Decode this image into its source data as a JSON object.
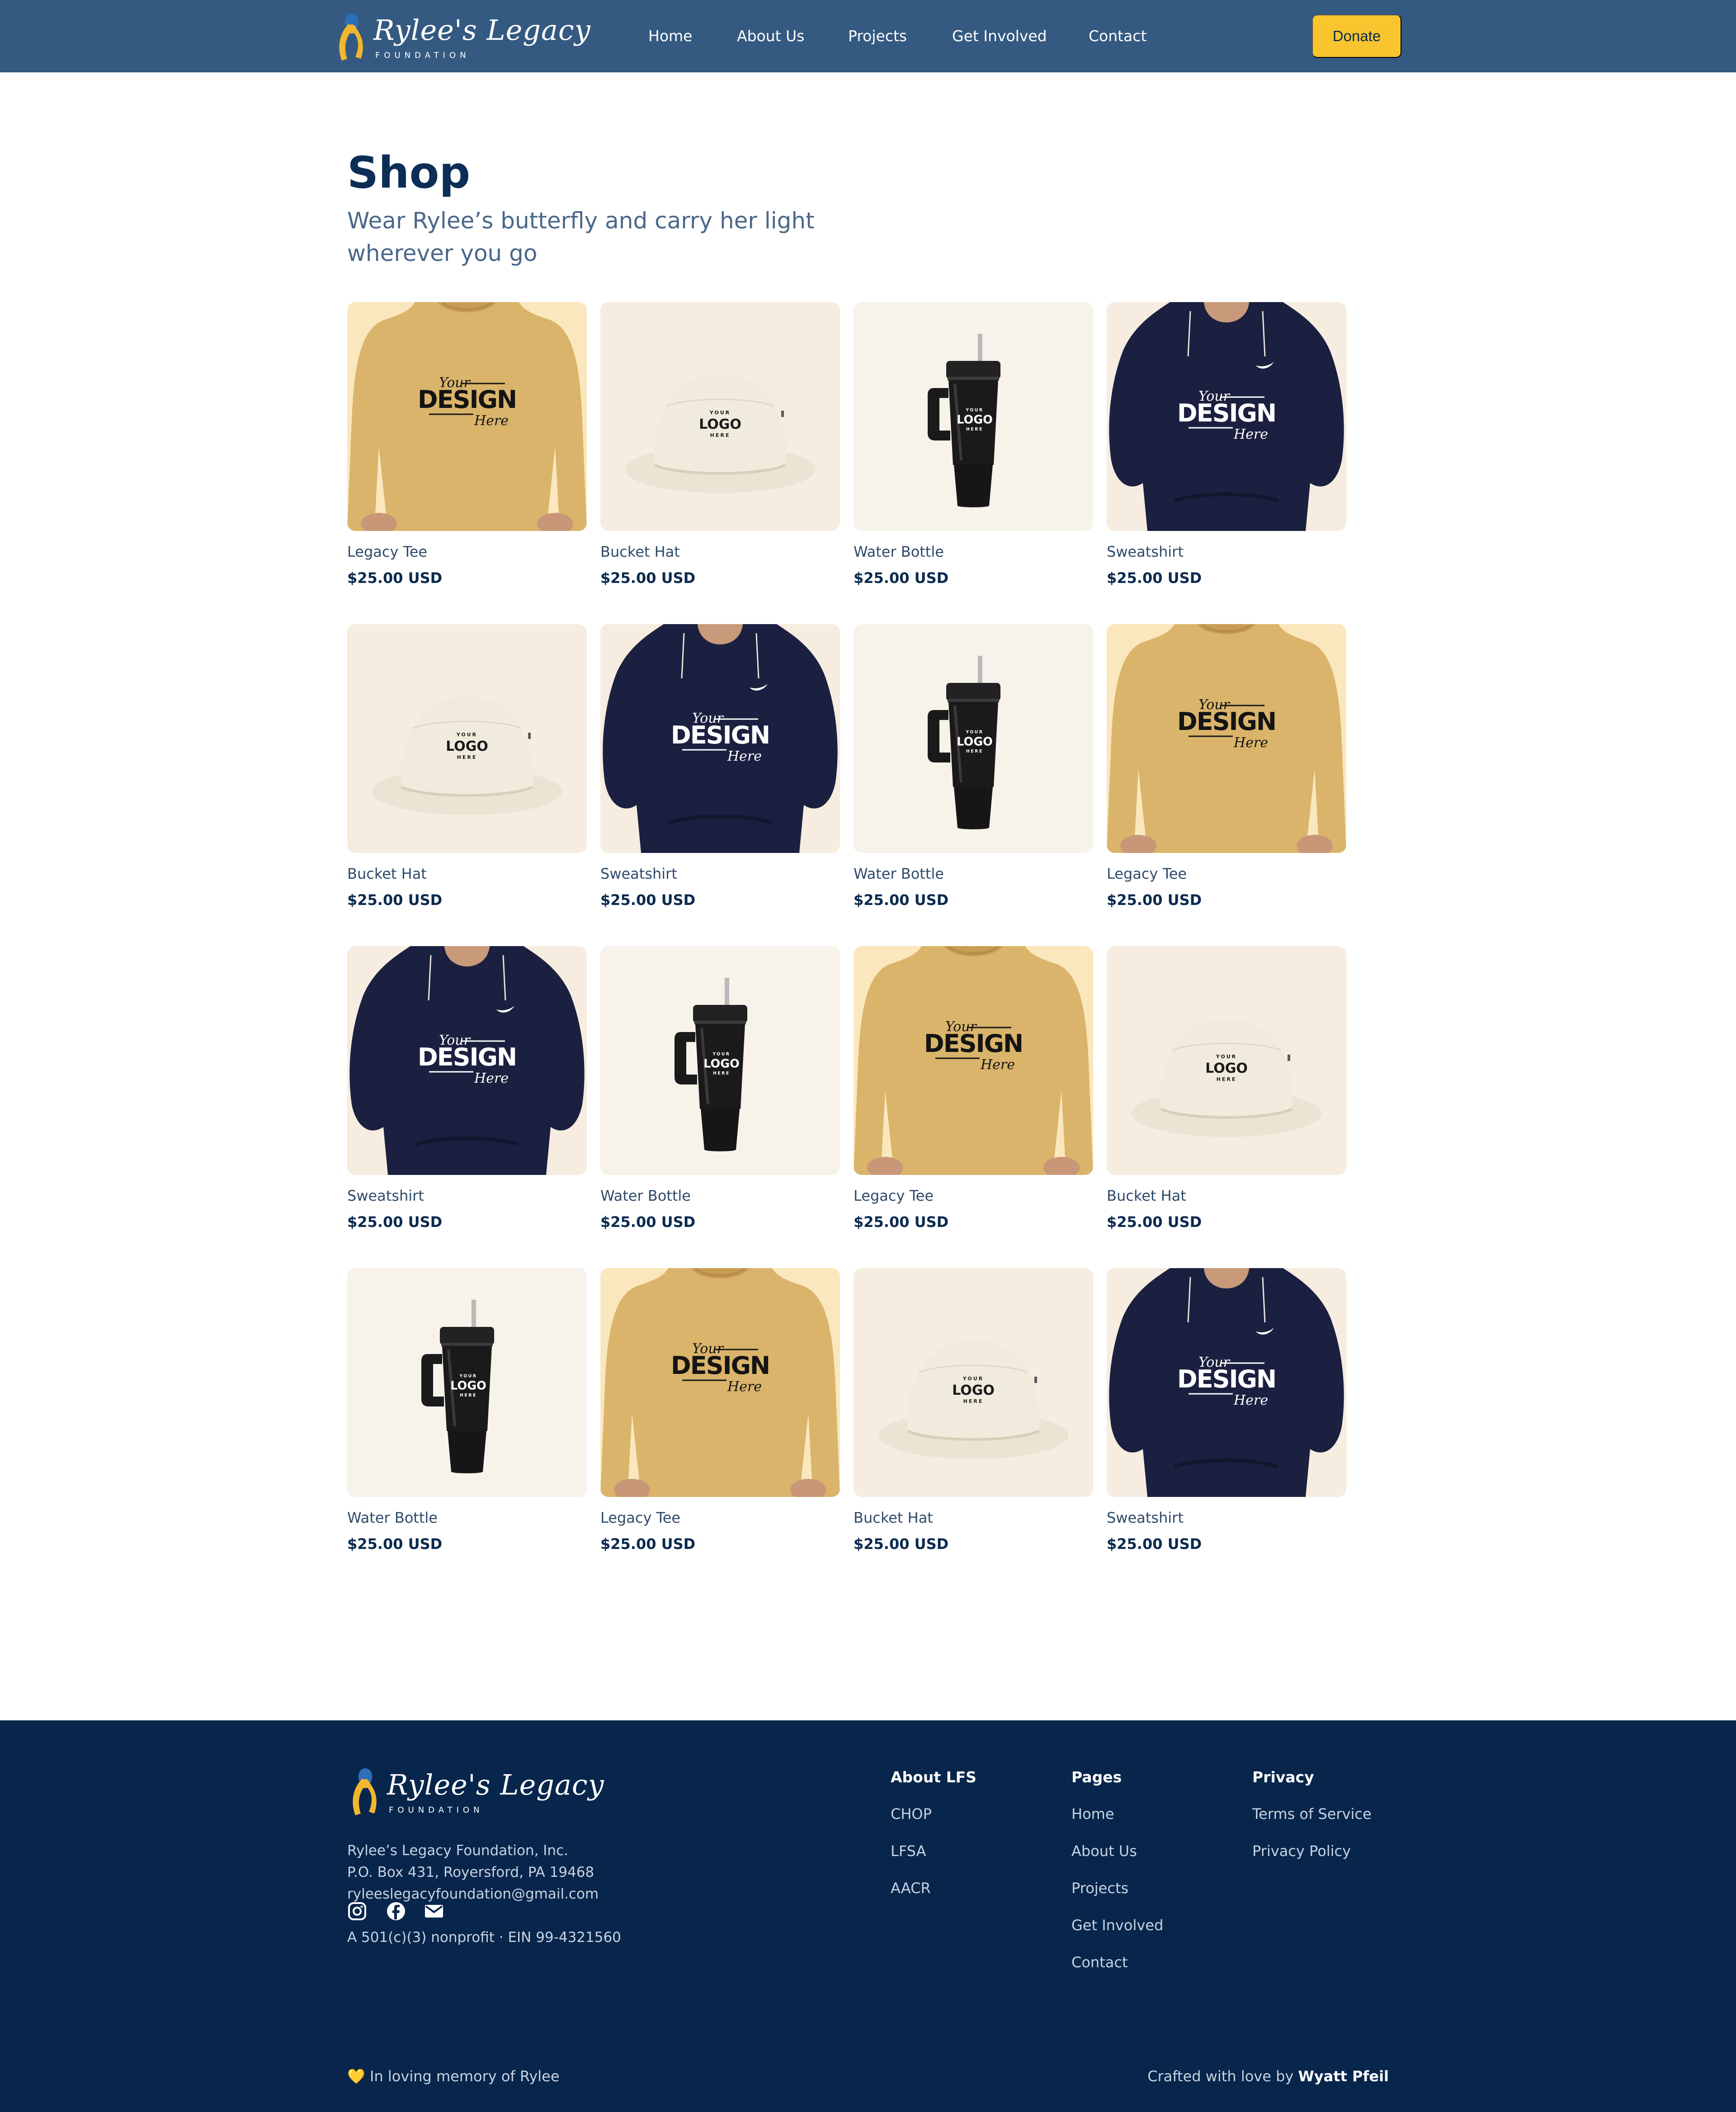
{
  "nav": {
    "brand_name": "Rylee's Legacy",
    "brand_sub": "FOUNDATION",
    "links": [
      "Home",
      "About Us",
      "Projects",
      "Get Involved",
      "Contact"
    ],
    "donate_label": "Donate"
  },
  "header": {
    "title": "Shop",
    "subtitle": "Wear Rylee’s butterfly and carry her light wherever you go"
  },
  "mockup_text": {
    "design_your": "Your",
    "design_main": "DESIGN",
    "design_here": "Here",
    "logo_your": "YOUR",
    "logo_main": "LOGO",
    "logo_here": "HERE"
  },
  "products": [
    {
      "name": "Legacy Tee",
      "price": "$25.00 USD",
      "icon": "tee-mockup"
    },
    {
      "name": "Bucket Hat",
      "price": "$25.00 USD",
      "icon": "bucket-hat-mockup"
    },
    {
      "name": "Water Bottle",
      "price": "$25.00 USD",
      "icon": "water-bottle-mockup"
    },
    {
      "name": "Sweatshirt",
      "price": "$25.00 USD",
      "icon": "sweatshirt-mockup"
    },
    {
      "name": "Bucket Hat",
      "price": "$25.00 USD",
      "icon": "bucket-hat-mockup"
    },
    {
      "name": "Sweatshirt",
      "price": "$25.00 USD",
      "icon": "sweatshirt-mockup"
    },
    {
      "name": "Water Bottle",
      "price": "$25.00 USD",
      "icon": "water-bottle-mockup"
    },
    {
      "name": "Legacy Tee",
      "price": "$25.00 USD",
      "icon": "tee-mockup"
    },
    {
      "name": "Sweatshirt",
      "price": "$25.00 USD",
      "icon": "sweatshirt-mockup"
    },
    {
      "name": "Water Bottle",
      "price": "$25.00 USD",
      "icon": "water-bottle-mockup"
    },
    {
      "name": "Legacy Tee",
      "price": "$25.00 USD",
      "icon": "tee-mockup"
    },
    {
      "name": "Bucket Hat",
      "price": "$25.00 USD",
      "icon": "bucket-hat-mockup"
    },
    {
      "name": "Water Bottle",
      "price": "$25.00 USD",
      "icon": "water-bottle-mockup"
    },
    {
      "name": "Legacy Tee",
      "price": "$25.00 USD",
      "icon": "tee-mockup"
    },
    {
      "name": "Bucket Hat",
      "price": "$25.00 USD",
      "icon": "bucket-hat-mockup"
    },
    {
      "name": "Sweatshirt",
      "price": "$25.00 USD",
      "icon": "sweatshirt-mockup"
    }
  ],
  "footer": {
    "org_name": "Rylee’s Legacy Foundation, Inc.",
    "address": "P.O. Box 431, Royersford, PA 19468",
    "email": "ryleeslegacyfoundation@gmail.com",
    "nonprofit": "A 501(c)(3) nonprofit · EIN 99-4321560",
    "columns": [
      {
        "heading": "About LFS",
        "links": [
          "CHOP",
          "LFSA",
          "AACR"
        ]
      },
      {
        "heading": "Pages",
        "links": [
          "Home",
          "About Us",
          "Projects",
          "Get Involved",
          "Contact"
        ]
      },
      {
        "heading": "Privacy",
        "links": [
          "Terms of Service",
          "Privacy Policy"
        ]
      }
    ],
    "social_icons": [
      "instagram-icon",
      "facebook-icon",
      "email-icon"
    ],
    "memory_heart": "💛",
    "memory": "In loving memory of Rylee",
    "credit_prefix": "Crafted with love by",
    "credit_name": "Wyatt Pfeil"
  },
  "colors": {
    "nav_bg": "#355a81",
    "donate": "#f8c52e",
    "footer_bg": "#08264c",
    "title": "#0b2e57",
    "ribbon_gold": "#f2b630",
    "ribbon_blue": "#2d6fb8",
    "tee": "#d9b46a",
    "hoodie": "#1b2040",
    "hat": "#ece6d8",
    "bottle": "#1a1a1a",
    "card_bg": "#f6efe4"
  }
}
